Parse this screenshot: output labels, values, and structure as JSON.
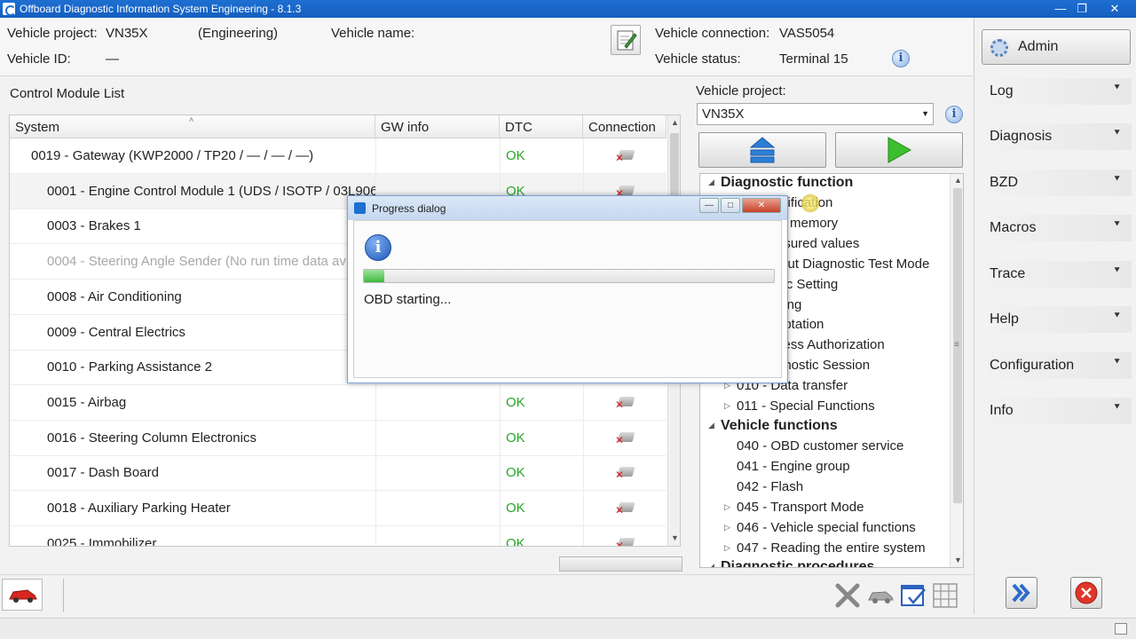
{
  "window": {
    "title": "Offboard Diagnostic Information System Engineering - 8.1.3"
  },
  "header": {
    "vehicle_project_label": "Vehicle project:",
    "vehicle_project_value": "VN35X",
    "mode": "(Engineering)",
    "vehicle_name_label": "Vehicle name:",
    "vehicle_id_label": "Vehicle ID:",
    "vehicle_id_value": "—",
    "vehicle_connection_label": "Vehicle connection:",
    "vehicle_connection_value": "VAS5054",
    "vehicle_status_label": "Vehicle status:",
    "vehicle_status_value": "Terminal 15"
  },
  "sidebar": {
    "admin_label": "Admin",
    "items": [
      {
        "label": "Log"
      },
      {
        "label": "Diagnosis"
      },
      {
        "label": "BZD"
      },
      {
        "label": "Macros"
      },
      {
        "label": "Trace"
      },
      {
        "label": "Help"
      },
      {
        "label": "Configuration"
      },
      {
        "label": "Info"
      }
    ]
  },
  "module_list": {
    "title": "Control Module List",
    "columns": [
      "System",
      "GW info",
      "DTC",
      "Connection"
    ],
    "rows": [
      {
        "system": "0019 - Gateway  (KWP2000 / TP20 / — / — / —)",
        "dtc": "OK",
        "indent": 1
      },
      {
        "system": "0001 - Engine Control Module 1  (UDS / ISOTP / 03L906",
        "dtc": "OK",
        "indent": 2
      },
      {
        "system": "0003 - Brakes 1",
        "dtc": "",
        "indent": 2
      },
      {
        "system": "0004 - Steering Angle Sender  (No run time data av",
        "dtc": "",
        "indent": 2
      },
      {
        "system": "0008 - Air Conditioning",
        "dtc": "",
        "indent": 2
      },
      {
        "system": "0009 - Central Electrics",
        "dtc": "",
        "indent": 2
      },
      {
        "system": "0010 - Parking Assistance 2",
        "dtc": "",
        "indent": 2
      },
      {
        "system": "0015 - Airbag",
        "dtc": "OK",
        "indent": 2
      },
      {
        "system": "0016 - Steering Column Electronics",
        "dtc": "OK",
        "indent": 2
      },
      {
        "system": "0017 - Dash Board",
        "dtc": "OK",
        "indent": 2
      },
      {
        "system": "0018 - Auxiliary Parking Heater",
        "dtc": "OK",
        "indent": 2
      },
      {
        "system": "0025 - Immobilizer",
        "dtc": "OK",
        "indent": 2
      }
    ]
  },
  "right_panel": {
    "vehicle_project_label": "Vehicle project:",
    "vehicle_project_value": "VN35X",
    "tree": {
      "diagnostic_function": "Diagnostic function",
      "df_items": [
        "ntification",
        "C memory",
        "asured values",
        "tput Diagnostic Test Mode",
        "sic Setting",
        "ding",
        "aptation",
        "cess Authorization",
        "gnostic Session",
        "010 - Data transfer",
        "011 - Special Functions"
      ],
      "vehicle_functions": "Vehicle functions",
      "vf_items": [
        "040 - OBD customer service",
        "041 - Engine group",
        "042 - Flash",
        "045 - Transport Mode",
        "046 - Vehicle special functions",
        "047 - Reading the entire system"
      ],
      "diagnostic_procedures": "Diagnostic procedures"
    }
  },
  "dialog": {
    "title": "Progress dialog",
    "message": "OBD starting...",
    "progress": 0.05
  },
  "colors": {
    "accent": "#1d6fd1",
    "ok": "#26a626",
    "error": "#d22222"
  }
}
